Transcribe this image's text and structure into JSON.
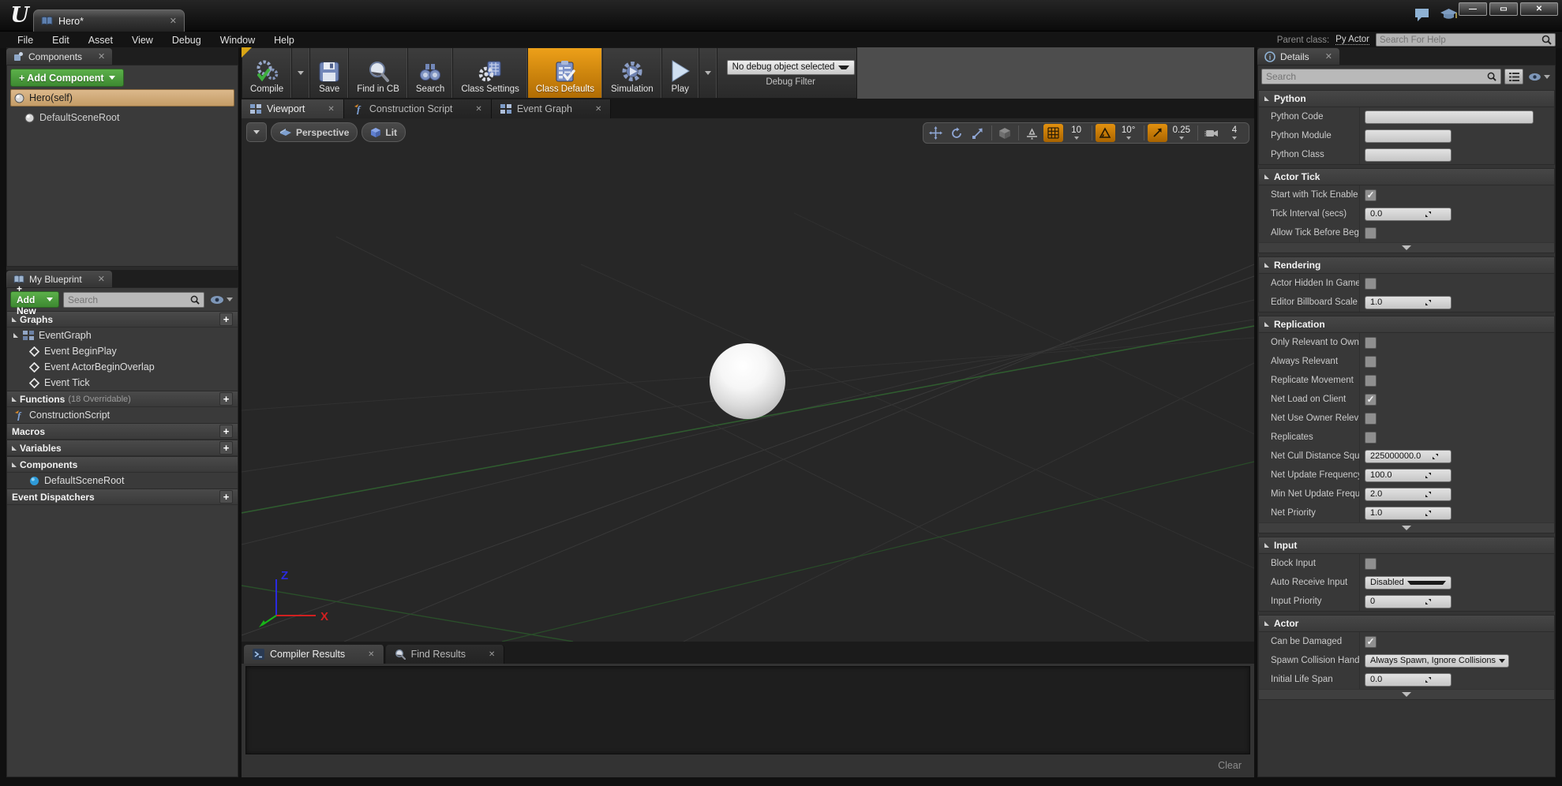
{
  "titlebar": {
    "tab_title": "Hero*"
  },
  "menubar": {
    "items": [
      "File",
      "Edit",
      "Asset",
      "View",
      "Debug",
      "Window",
      "Help"
    ]
  },
  "parent_class": {
    "label": "Parent class:",
    "value": "Py Actor"
  },
  "help_search_placeholder": "Search For Help",
  "toolbar": {
    "buttons": [
      {
        "label": "Compile",
        "icon": "compile",
        "caret": true
      },
      {
        "label": "Save",
        "icon": "save"
      },
      {
        "label": "Find in CB",
        "icon": "find-in-cb"
      },
      {
        "label": "Search",
        "icon": "binoculars"
      },
      {
        "label": "Class Settings",
        "icon": "class-settings"
      },
      {
        "label": "Class Defaults",
        "icon": "class-defaults",
        "active": true
      },
      {
        "label": "Simulation",
        "icon": "simulation"
      },
      {
        "label": "Play",
        "icon": "play"
      }
    ],
    "debug_dropdown_value": "No debug object selected",
    "debug_filter_label": "Debug Filter"
  },
  "components_panel": {
    "tab": "Components",
    "add_button": "+ Add Component",
    "items": [
      {
        "label": "Hero(self)",
        "icon": "sphere",
        "selected": true,
        "indent": 0
      },
      {
        "label": "DefaultSceneRoot",
        "icon": "sphere",
        "selected": false,
        "indent": 1
      }
    ]
  },
  "my_blueprint": {
    "tab": "My Blueprint",
    "add_button": "+ Add New",
    "search_placeholder": "Search",
    "sections": [
      {
        "title": "Graphs",
        "collapsible": true,
        "plus": true,
        "items": [
          {
            "label": "EventGraph",
            "icon": "graph",
            "indent": 0,
            "arrow": true
          },
          {
            "label": "Event BeginPlay",
            "icon": "event",
            "indent": 1
          },
          {
            "label": "Event ActorBeginOverlap",
            "icon": "event",
            "indent": 1
          },
          {
            "label": "Event Tick",
            "icon": "event",
            "indent": 1
          }
        ]
      },
      {
        "title": "Functions",
        "suffix": "(18 Overridable)",
        "collapsible": true,
        "plus": true,
        "items": [
          {
            "label": "ConstructionScript",
            "icon": "function",
            "indent": 0
          }
        ]
      },
      {
        "title": "Macros",
        "collapsible": false,
        "plus": true,
        "items": []
      },
      {
        "title": "Variables",
        "collapsible": true,
        "plus": true,
        "items": []
      },
      {
        "title": "Components",
        "collapsible": true,
        "plus": false,
        "items": [
          {
            "label": "DefaultSceneRoot",
            "icon": "sphere-blue",
            "indent": 1
          }
        ]
      },
      {
        "title": "Event Dispatchers",
        "collapsible": false,
        "plus": true,
        "items": []
      }
    ]
  },
  "doc_tabs": [
    {
      "label": "Viewport",
      "icon": "grid-squares",
      "active": true
    },
    {
      "label": "Construction Script",
      "icon": "function",
      "active": false
    },
    {
      "label": "Event Graph",
      "icon": "grid-squares",
      "active": false
    }
  ],
  "viewport_bar": {
    "perspective_label": "Perspective",
    "lit_label": "Lit",
    "grid_snap_value": "10",
    "rotation_snap_value": "10°",
    "scale_snap_value": "0.25",
    "camera_speed_value": "4"
  },
  "bottom_panel": {
    "tabs": [
      {
        "label": "Compiler Results",
        "icon": "console",
        "active": true
      },
      {
        "label": "Find Results",
        "icon": "magnifier",
        "active": false
      }
    ],
    "clear_button": "Clear"
  },
  "details": {
    "tab": "Details",
    "search_placeholder": "Search",
    "sections": [
      {
        "title": "Python",
        "rows": [
          {
            "label": "Python Code",
            "control": "text",
            "size": "wide"
          },
          {
            "label": "Python Module",
            "control": "text",
            "size": "med"
          },
          {
            "label": "Python Class",
            "control": "text",
            "size": "med"
          }
        ]
      },
      {
        "title": "Actor Tick",
        "expander": true,
        "rows": [
          {
            "label": "Start with Tick Enable",
            "control": "checkbox",
            "checked": true
          },
          {
            "label": "Tick Interval (secs)",
            "control": "number",
            "value": "0.0"
          },
          {
            "label": "Allow Tick Before Beg",
            "control": "checkbox",
            "checked": false
          }
        ]
      },
      {
        "title": "Rendering",
        "rows": [
          {
            "label": "Actor Hidden In Game",
            "control": "checkbox",
            "checked": false
          },
          {
            "label": "Editor Billboard Scale",
            "control": "number",
            "value": "1.0"
          }
        ]
      },
      {
        "title": "Replication",
        "expander": true,
        "rows": [
          {
            "label": "Only Relevant to Own",
            "control": "checkbox",
            "checked": false
          },
          {
            "label": "Always Relevant",
            "control": "checkbox",
            "checked": false
          },
          {
            "label": "Replicate Movement",
            "control": "checkbox",
            "checked": false
          },
          {
            "label": "Net Load on Client",
            "control": "checkbox",
            "checked": true
          },
          {
            "label": "Net Use Owner Relev",
            "control": "checkbox",
            "checked": false
          },
          {
            "label": "Replicates",
            "control": "checkbox",
            "checked": false
          },
          {
            "label": "Net Cull Distance Squ",
            "control": "number",
            "value": "225000000.0"
          },
          {
            "label": "Net Update Frequency",
            "control": "number",
            "value": "100.0"
          },
          {
            "label": "Min Net Update Frequ",
            "control": "number",
            "value": "2.0"
          },
          {
            "label": "Net Priority",
            "control": "number",
            "value": "1.0"
          }
        ]
      },
      {
        "title": "Input",
        "rows": [
          {
            "label": "Block Input",
            "control": "checkbox",
            "checked": false
          },
          {
            "label": "Auto Receive Input",
            "control": "select",
            "value": "Disabled"
          },
          {
            "label": "Input Priority",
            "control": "number",
            "value": "0"
          }
        ]
      },
      {
        "title": "Actor",
        "expander": true,
        "rows": [
          {
            "label": "Can be Damaged",
            "control": "checkbox",
            "checked": true
          },
          {
            "label": "Spawn Collision Hand",
            "control": "select",
            "value": "Always Spawn, Ignore Collisions",
            "size": "wide"
          },
          {
            "label": "Initial Life Span",
            "control": "number",
            "value": "0.0"
          }
        ]
      }
    ]
  },
  "colors": {
    "accent_orange": "#e8960c",
    "accent_green": "#4a9b3c",
    "selection_tan": "#c8a06a",
    "viewport_bg": "#272727"
  }
}
